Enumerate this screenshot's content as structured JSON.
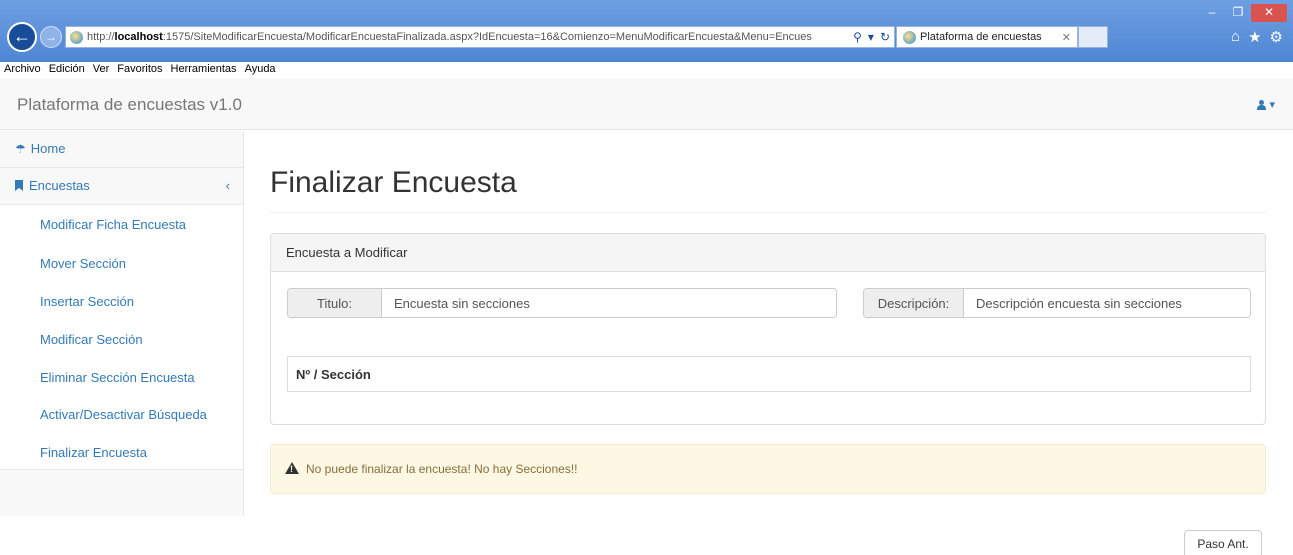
{
  "browser": {
    "url_prefix": "http://",
    "url_host": "localhost",
    "url_rest": ":1575/SiteModificarEncuesta/ModificarEncuestaFinalizada.aspx?IdEncuesta=16&Comienzo=MenuModificarEncuesta&Menu=Encues",
    "tab_title": "Plataforma de encuestas",
    "menu": [
      "Archivo",
      "Edición",
      "Ver",
      "Favoritos",
      "Herramientas",
      "Ayuda"
    ]
  },
  "navbar": {
    "brand": "Plataforma de encuestas v1.0"
  },
  "sidebar": {
    "home": "Home",
    "encuestas": "Encuestas",
    "items": [
      "Modificar Ficha Encuesta",
      "Mover Sección",
      "Insertar Sección",
      "Modificar Sección",
      "Eliminar Sección Encuesta",
      "Activar/Desactivar Búsqueda",
      "Finalizar Encuesta"
    ]
  },
  "main": {
    "title": "Finalizar Encuesta",
    "panel_heading": "Encuesta a Modificar",
    "titulo_label": "Titulo:",
    "titulo_value": "Encuesta sin secciones",
    "descripcion_label": "Descripción:",
    "descripcion_value": "Descripción encuesta sin secciones",
    "table_header": "Nº / Sección",
    "alert_text": "No puede finalizar la encuesta! No hay Secciones!!",
    "prev_button": "Paso Ant."
  },
  "colors": {
    "link": "#337ab7",
    "alert_bg": "#fcf8e3",
    "ie_chrome": "#5a8fd8"
  }
}
